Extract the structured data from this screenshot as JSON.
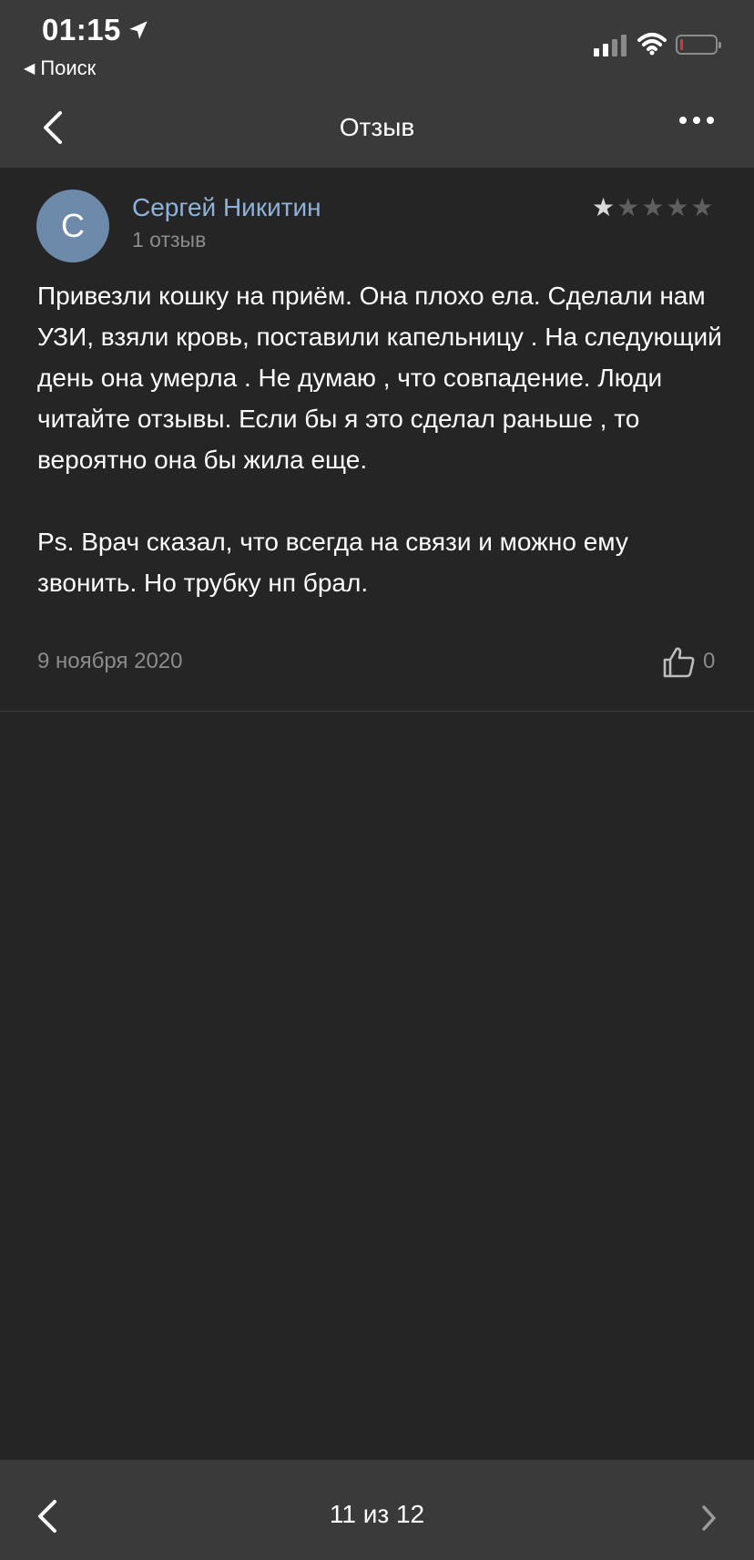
{
  "status_bar": {
    "time": "01:15",
    "back_app": "Поиск"
  },
  "nav": {
    "title": "Отзыв"
  },
  "review": {
    "avatar_letter": "С",
    "author": "Сергей Никитин",
    "reviews_count": "1 отзыв",
    "rating": 1,
    "rating_max": 5,
    "text": "Привезли кошку на приём. Она плохо ела. Сделали нам УЗИ, взяли кровь, поставили капельницу . На следующий день она умерла . Не думаю , что совпадение. Люди читайте отзывы. Если бы я это сделал раньше , то вероятно она бы жила еще.\n\nPs. Врач сказал, что всегда на связи и можно ему звонить. Но трубку нп брал.",
    "date": "9 ноября 2020",
    "likes": "0"
  },
  "pager": {
    "label": "11 из 12"
  },
  "colors": {
    "background": "#252525",
    "bar": "#3a3a3a",
    "author_link": "#8fb2da",
    "avatar": "#6e8aaa",
    "muted_text": "#8c8c8c",
    "battery_low": "#e0303a"
  },
  "icons": {
    "location": "location-arrow-icon",
    "signal": "cellular-signal-icon",
    "wifi": "wifi-icon",
    "battery": "battery-icon",
    "back": "chevron-left-icon",
    "more": "more-dots-icon",
    "like": "thumbs-up-icon",
    "prev": "chevron-left-icon",
    "next": "chevron-right-icon"
  }
}
